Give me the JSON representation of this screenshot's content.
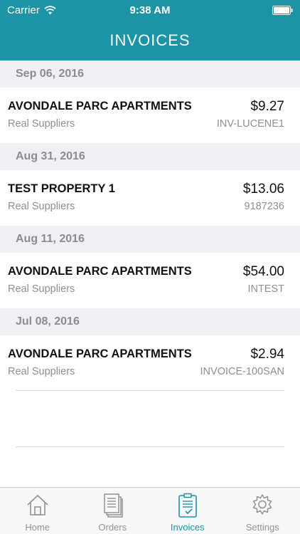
{
  "status_bar": {
    "carrier": "Carrier",
    "time": "9:38 AM"
  },
  "header": {
    "title": "INVOICES",
    "color": "#1d93a6"
  },
  "invoices": [
    {
      "date": "Sep 06, 2016",
      "name": "AVONDALE PARC APARTMENTS",
      "amount": "$9.27",
      "supplier": "Real Suppliers",
      "ref": "INV-LUCENE1"
    },
    {
      "date": "Aug 31, 2016",
      "name": "TEST PROPERTY 1",
      "amount": "$13.06",
      "supplier": "Real Suppliers",
      "ref": "9187236"
    },
    {
      "date": "Aug 11, 2016",
      "name": "AVONDALE PARC APARTMENTS",
      "amount": "$54.00",
      "supplier": "Real Suppliers",
      "ref": "INTEST"
    },
    {
      "date": "Jul 08, 2016",
      "name": "AVONDALE PARC APARTMENTS",
      "amount": "$2.94",
      "supplier": "Real Suppliers",
      "ref": "INVOICE-100SAN"
    }
  ],
  "tab_bar": {
    "active_color": "#1d93a6",
    "tabs": [
      {
        "label": "Home",
        "icon": "home-icon"
      },
      {
        "label": "Orders",
        "icon": "orders-icon"
      },
      {
        "label": "Invoices",
        "icon": "invoices-icon",
        "active": true
      },
      {
        "label": "Settings",
        "icon": "gear-icon"
      }
    ]
  }
}
